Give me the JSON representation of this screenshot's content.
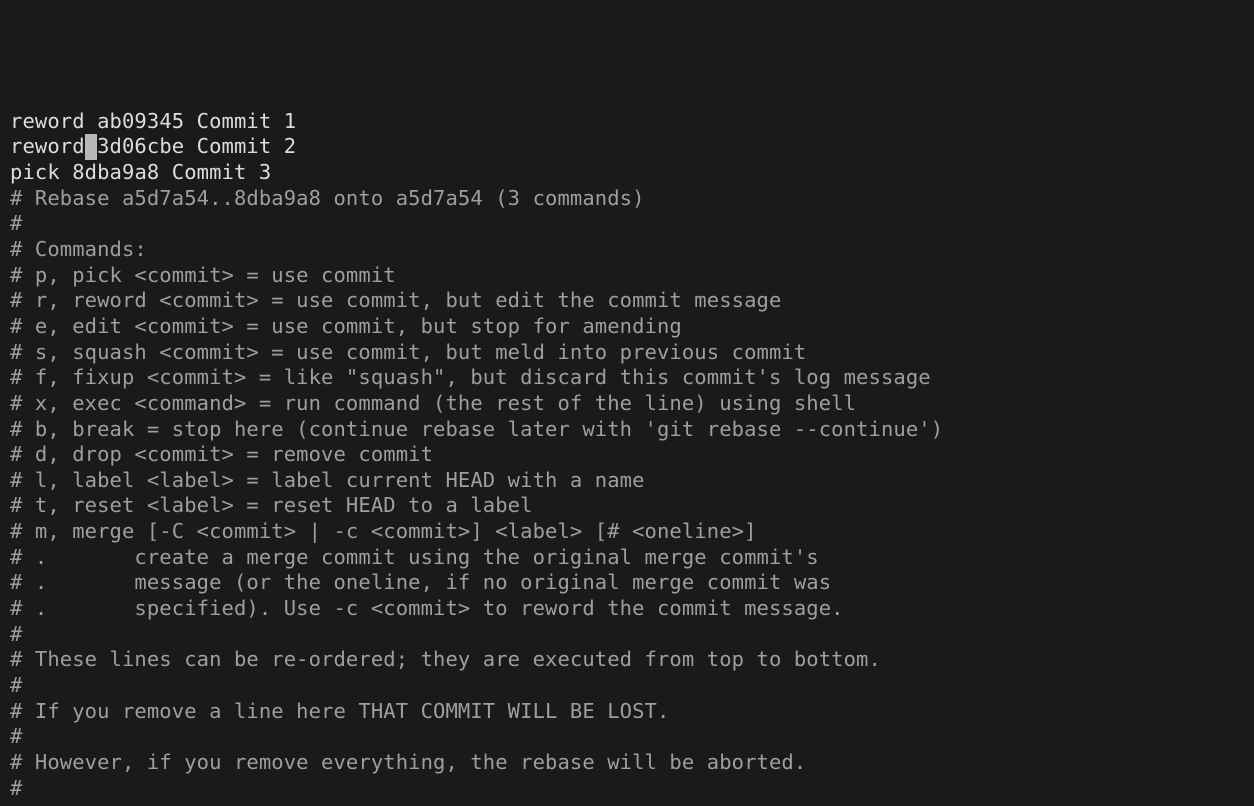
{
  "commits": [
    {
      "action": "reword",
      "hash": "ab09345",
      "message": "Commit 1"
    },
    {
      "action": "reword",
      "hash": "3d06cbe",
      "message": "Commit 2"
    },
    {
      "action": "pick",
      "hash": "8dba9a8",
      "message": "Commit 3"
    }
  ],
  "cursor_line_index": 1,
  "cursor_after_action": true,
  "blank_line": "",
  "comments": [
    "# Rebase a5d7a54..8dba9a8 onto a5d7a54 (3 commands)",
    "#",
    "# Commands:",
    "# p, pick <commit> = use commit",
    "# r, reword <commit> = use commit, but edit the commit message",
    "# e, edit <commit> = use commit, but stop for amending",
    "# s, squash <commit> = use commit, but meld into previous commit",
    "# f, fixup <commit> = like \"squash\", but discard this commit's log message",
    "# x, exec <command> = run command (the rest of the line) using shell",
    "# b, break = stop here (continue rebase later with 'git rebase --continue')",
    "# d, drop <commit> = remove commit",
    "# l, label <label> = label current HEAD with a name",
    "# t, reset <label> = reset HEAD to a label",
    "# m, merge [-C <commit> | -c <commit>] <label> [# <oneline>]",
    "# .       create a merge commit using the original merge commit's",
    "# .       message (or the oneline, if no original merge commit was",
    "# .       specified). Use -c <commit> to reword the commit message.",
    "#",
    "# These lines can be re-ordered; they are executed from top to bottom.",
    "#",
    "# If you remove a line here THAT COMMIT WILL BE LOST.",
    "#",
    "# However, if you remove everything, the rebase will be aborted.",
    "#"
  ]
}
